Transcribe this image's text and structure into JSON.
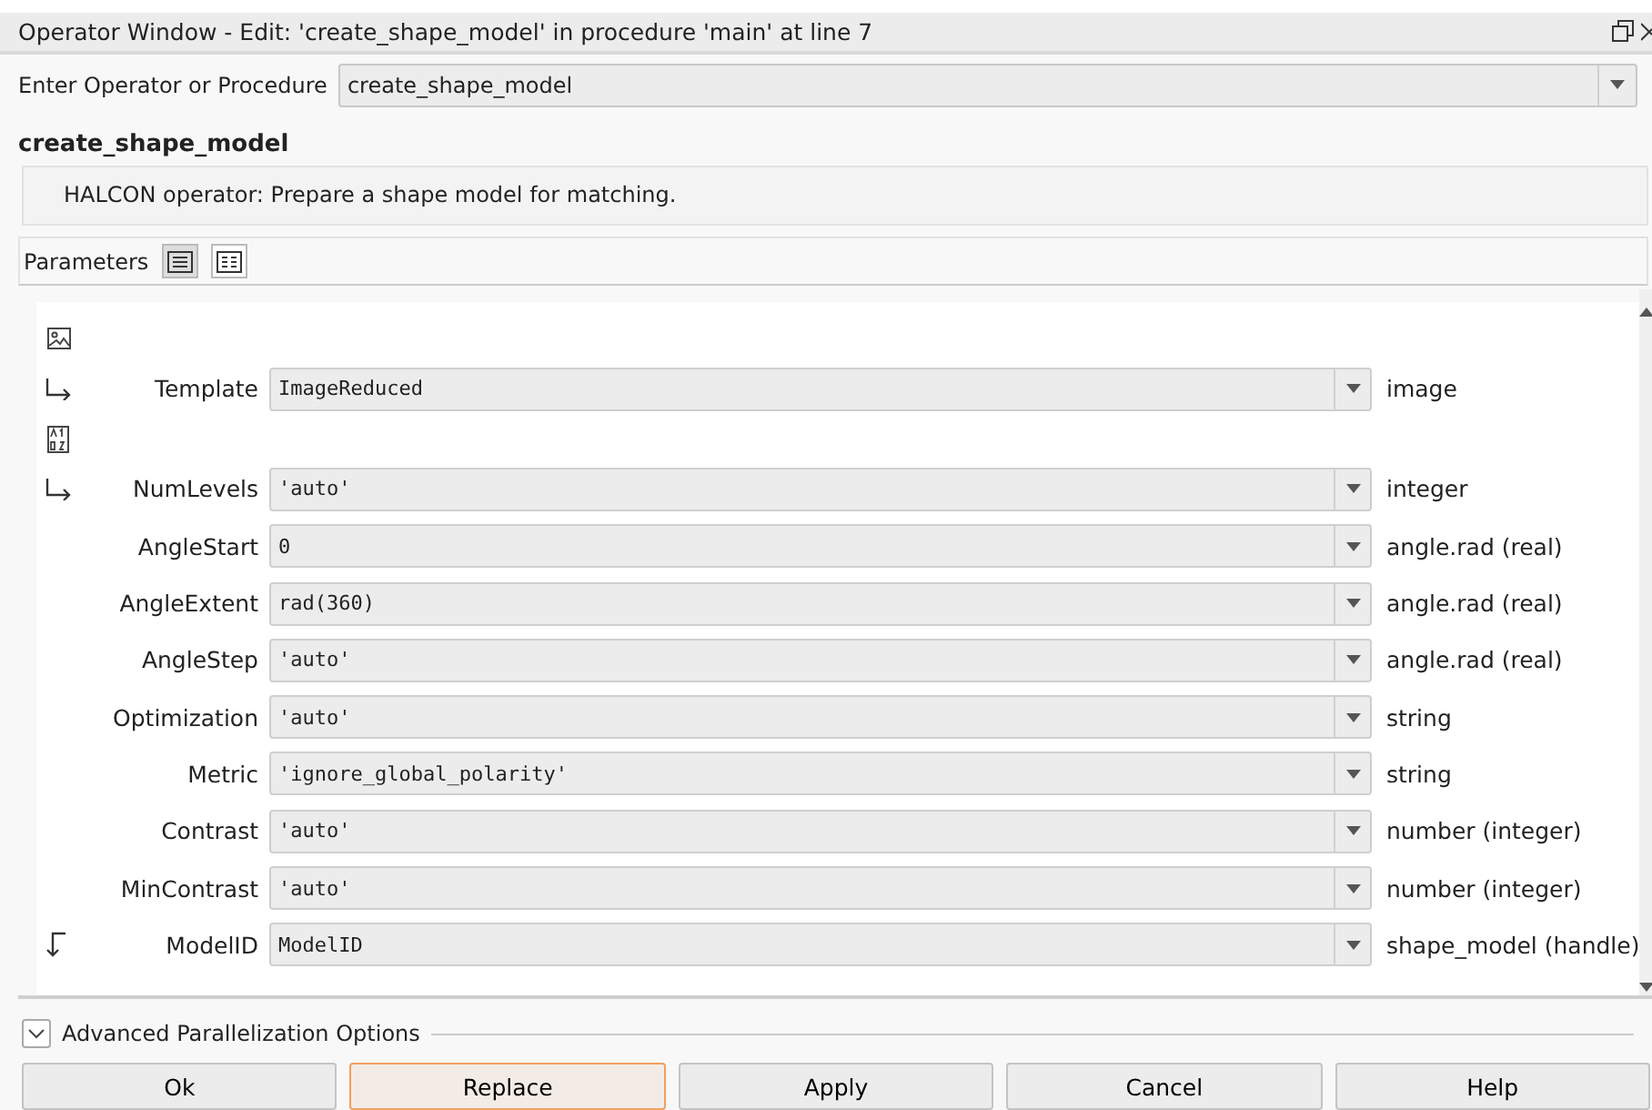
{
  "window": {
    "title": "Operator Window - Edit: 'create_shape_model' in procedure 'main' at line 7"
  },
  "operator_field": {
    "label": "Enter Operator or Procedure",
    "value": "create_shape_model"
  },
  "operator_name": "create_shape_model",
  "description": "HALCON operator:  Prepare a shape model for matching.",
  "parameters_header": {
    "label": "Parameters",
    "views": [
      {
        "kind": "list",
        "selected": true
      },
      {
        "kind": "grid",
        "selected": false
      }
    ]
  },
  "parameter_groups": [
    {
      "kind": "iconic_input",
      "params": [
        {
          "name": "Template",
          "value": "ImageReduced",
          "type": "image"
        }
      ]
    },
    {
      "kind": "control_input",
      "params": [
        {
          "name": "NumLevels",
          "value": "'auto'",
          "type": "integer"
        },
        {
          "name": "AngleStart",
          "value": "0",
          "type": "angle.rad (real)"
        },
        {
          "name": "AngleExtent",
          "value": "rad(360)",
          "type": "angle.rad (real)"
        },
        {
          "name": "AngleStep",
          "value": "'auto'",
          "type": "angle.rad (real)"
        },
        {
          "name": "Optimization",
          "value": "'auto'",
          "type": "string"
        },
        {
          "name": "Metric",
          "value": "'ignore_global_polarity'",
          "type": "string"
        },
        {
          "name": "Contrast",
          "value": "'auto'",
          "type": "number (integer)"
        },
        {
          "name": "MinContrast",
          "value": "'auto'",
          "type": "number (integer)"
        }
      ]
    },
    {
      "kind": "control_output",
      "params": [
        {
          "name": "ModelID",
          "value": "ModelID",
          "type": "shape_model (handle)"
        }
      ]
    }
  ],
  "advanced": {
    "label": "Advanced Parallelization Options",
    "expanded": false
  },
  "buttons": [
    {
      "label": "Ok",
      "default": false
    },
    {
      "label": "Replace",
      "default": true
    },
    {
      "label": "Apply",
      "default": false
    },
    {
      "label": "Cancel",
      "default": false
    },
    {
      "label": "Help",
      "default": false
    }
  ]
}
